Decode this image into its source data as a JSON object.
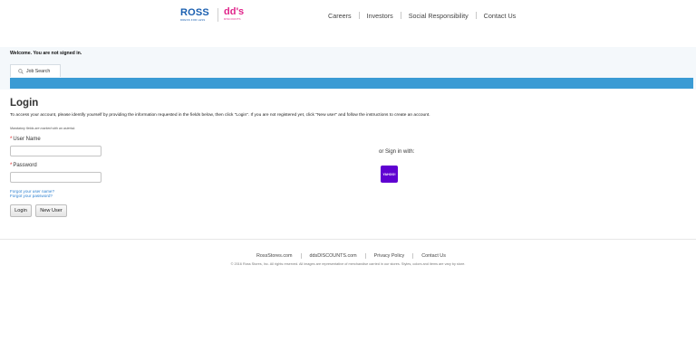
{
  "header": {
    "ross_logo": {
      "word": "ROSS",
      "tagline": "DRESS FOR LESS"
    },
    "dds_logo": {
      "word": "dd's",
      "tagline": "DISCOUNTS"
    },
    "nav": [
      "Careers",
      "Investors",
      "Social Responsibility",
      "Contact Us"
    ]
  },
  "welcome_text": "Welcome. You are not signed in.",
  "tabs": [
    {
      "label": "Job Search"
    }
  ],
  "login": {
    "title": "Login",
    "intro": "To access your account, please identify yourself by providing the information requested in the fields below, then click \"Login\". If you are not registered yet, click \"New user\" and follow the instructions to create an account.",
    "mandatory_note": "Mandatory fields are marked with an asterisk.",
    "required_marker": "*",
    "user_name_label": "User Name",
    "user_name_value": "",
    "password_label": "Password",
    "password_value": "",
    "forgot_user": "Forgot your user name?",
    "forgot_password": "Forgot your password?",
    "login_button": "Login",
    "new_user_button": "New User"
  },
  "social": {
    "or_sign_in": "or Sign in with:",
    "yahoo_label": "YAHOO!",
    "yahoo_color": "#5f01d1"
  },
  "footer": {
    "links": [
      "RossStores.com",
      "ddsDISCOUNTS.com",
      "Privacy Policy",
      "Contact Us"
    ],
    "copyright": "© 2016 Ross Stores, Inc. All rights reserved. All images are representative of merchandise carried in our stores. Styles, colors and items are vary by store."
  },
  "colors": {
    "accent_bar": "#3a9bd4",
    "ross_blue": "#1a5fb0",
    "dds_pink": "#e0248a",
    "link_blue": "#2a7fd0"
  }
}
